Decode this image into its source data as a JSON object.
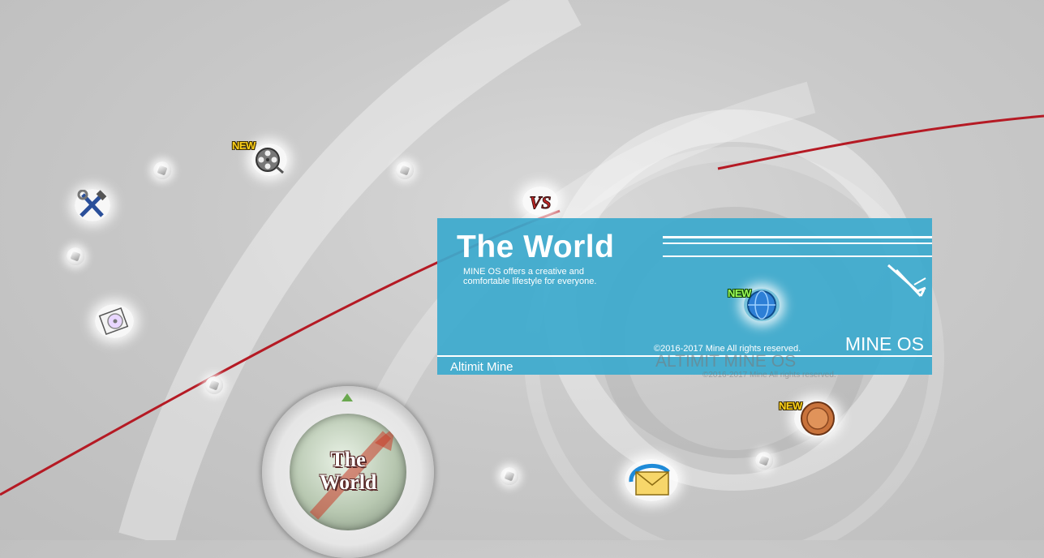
{
  "panel": {
    "title": "The World",
    "description_line1": "MINE OS offers a creative and",
    "description_line2": "comfortable lifestyle for everyone.",
    "copyright": "©2016-2017 Mine All rights reserved.",
    "brand": "MINE OS",
    "footer": "Altimit Mine"
  },
  "ghost": {
    "brand": "ALTIMIT MINE OS",
    "copyright": "©2016-2017 Mine All rights reserved."
  },
  "disc": {
    "line1": "The",
    "line2": "World"
  },
  "badges": {
    "new": "NEW"
  },
  "icons": {
    "movie": "film-reel-icon",
    "tools": "wrench-hammer-icon",
    "disk": "disk-icon",
    "versus": "vs-icon",
    "globe": "globe-icon",
    "coin": "coin-icon",
    "mail": "mail-icon",
    "feather": "feather-icon"
  },
  "colors": {
    "panel": "#3caacd",
    "arc": "#b51a24",
    "background": "#c9c9c9"
  }
}
